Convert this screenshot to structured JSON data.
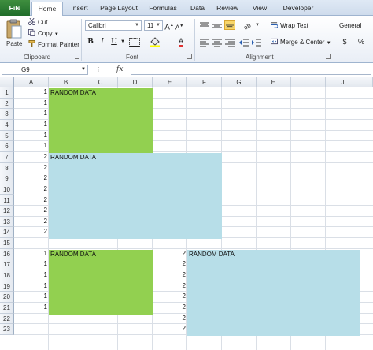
{
  "ribbon": {
    "tabs": [
      {
        "label": "File",
        "id": "file"
      },
      {
        "label": "Home",
        "id": "home"
      },
      {
        "label": "Insert",
        "id": "insert"
      },
      {
        "label": "Page Layout",
        "id": "page-layout"
      },
      {
        "label": "Formulas",
        "id": "formulas"
      },
      {
        "label": "Data",
        "id": "data"
      },
      {
        "label": "Review",
        "id": "review"
      },
      {
        "label": "View",
        "id": "view"
      },
      {
        "label": "Developer",
        "id": "developer"
      }
    ],
    "active_tab": "Home",
    "clipboard": {
      "paste": "Paste",
      "cut": "Cut",
      "copy": "Copy",
      "format_painter": "Format Painter",
      "group_label": "Clipboard"
    },
    "font": {
      "font_name": "Calibri",
      "font_size": "11",
      "bold": "B",
      "italic": "I",
      "underline": "U",
      "group_label": "Font"
    },
    "alignment": {
      "wrap_text": "Wrap Text",
      "merge_center": "Merge & Center",
      "group_label": "Alignment"
    },
    "number": {
      "format": "General",
      "dollar": "$",
      "percent": "%"
    }
  },
  "formula_bar": {
    "name_box": "G9",
    "fx": "fx",
    "content": ""
  },
  "sheet": {
    "columns": [
      "A",
      "B",
      "C",
      "D",
      "E",
      "F",
      "G",
      "H",
      "I",
      "J"
    ],
    "rows": [
      "1",
      "2",
      "3",
      "4",
      "5",
      "6",
      "7",
      "8",
      "9",
      "10",
      "11",
      "12",
      "13",
      "14",
      "15",
      "16",
      "17",
      "18",
      "19",
      "20",
      "21",
      "22",
      "23"
    ],
    "block_label": "RANDOM DATA",
    "colA": [
      "1",
      "1",
      "1",
      "1",
      "1",
      "1",
      "2",
      "2",
      "2",
      "2",
      "2",
      "2",
      "2",
      "2",
      "",
      "1",
      "1",
      "1",
      "1",
      "1",
      "1",
      "",
      ""
    ],
    "colE": [
      "2",
      "2",
      "2",
      "2",
      "2",
      "2",
      "2",
      "2"
    ],
    "colors": {
      "green": "#92d050",
      "blue": "#b7dee8"
    }
  }
}
